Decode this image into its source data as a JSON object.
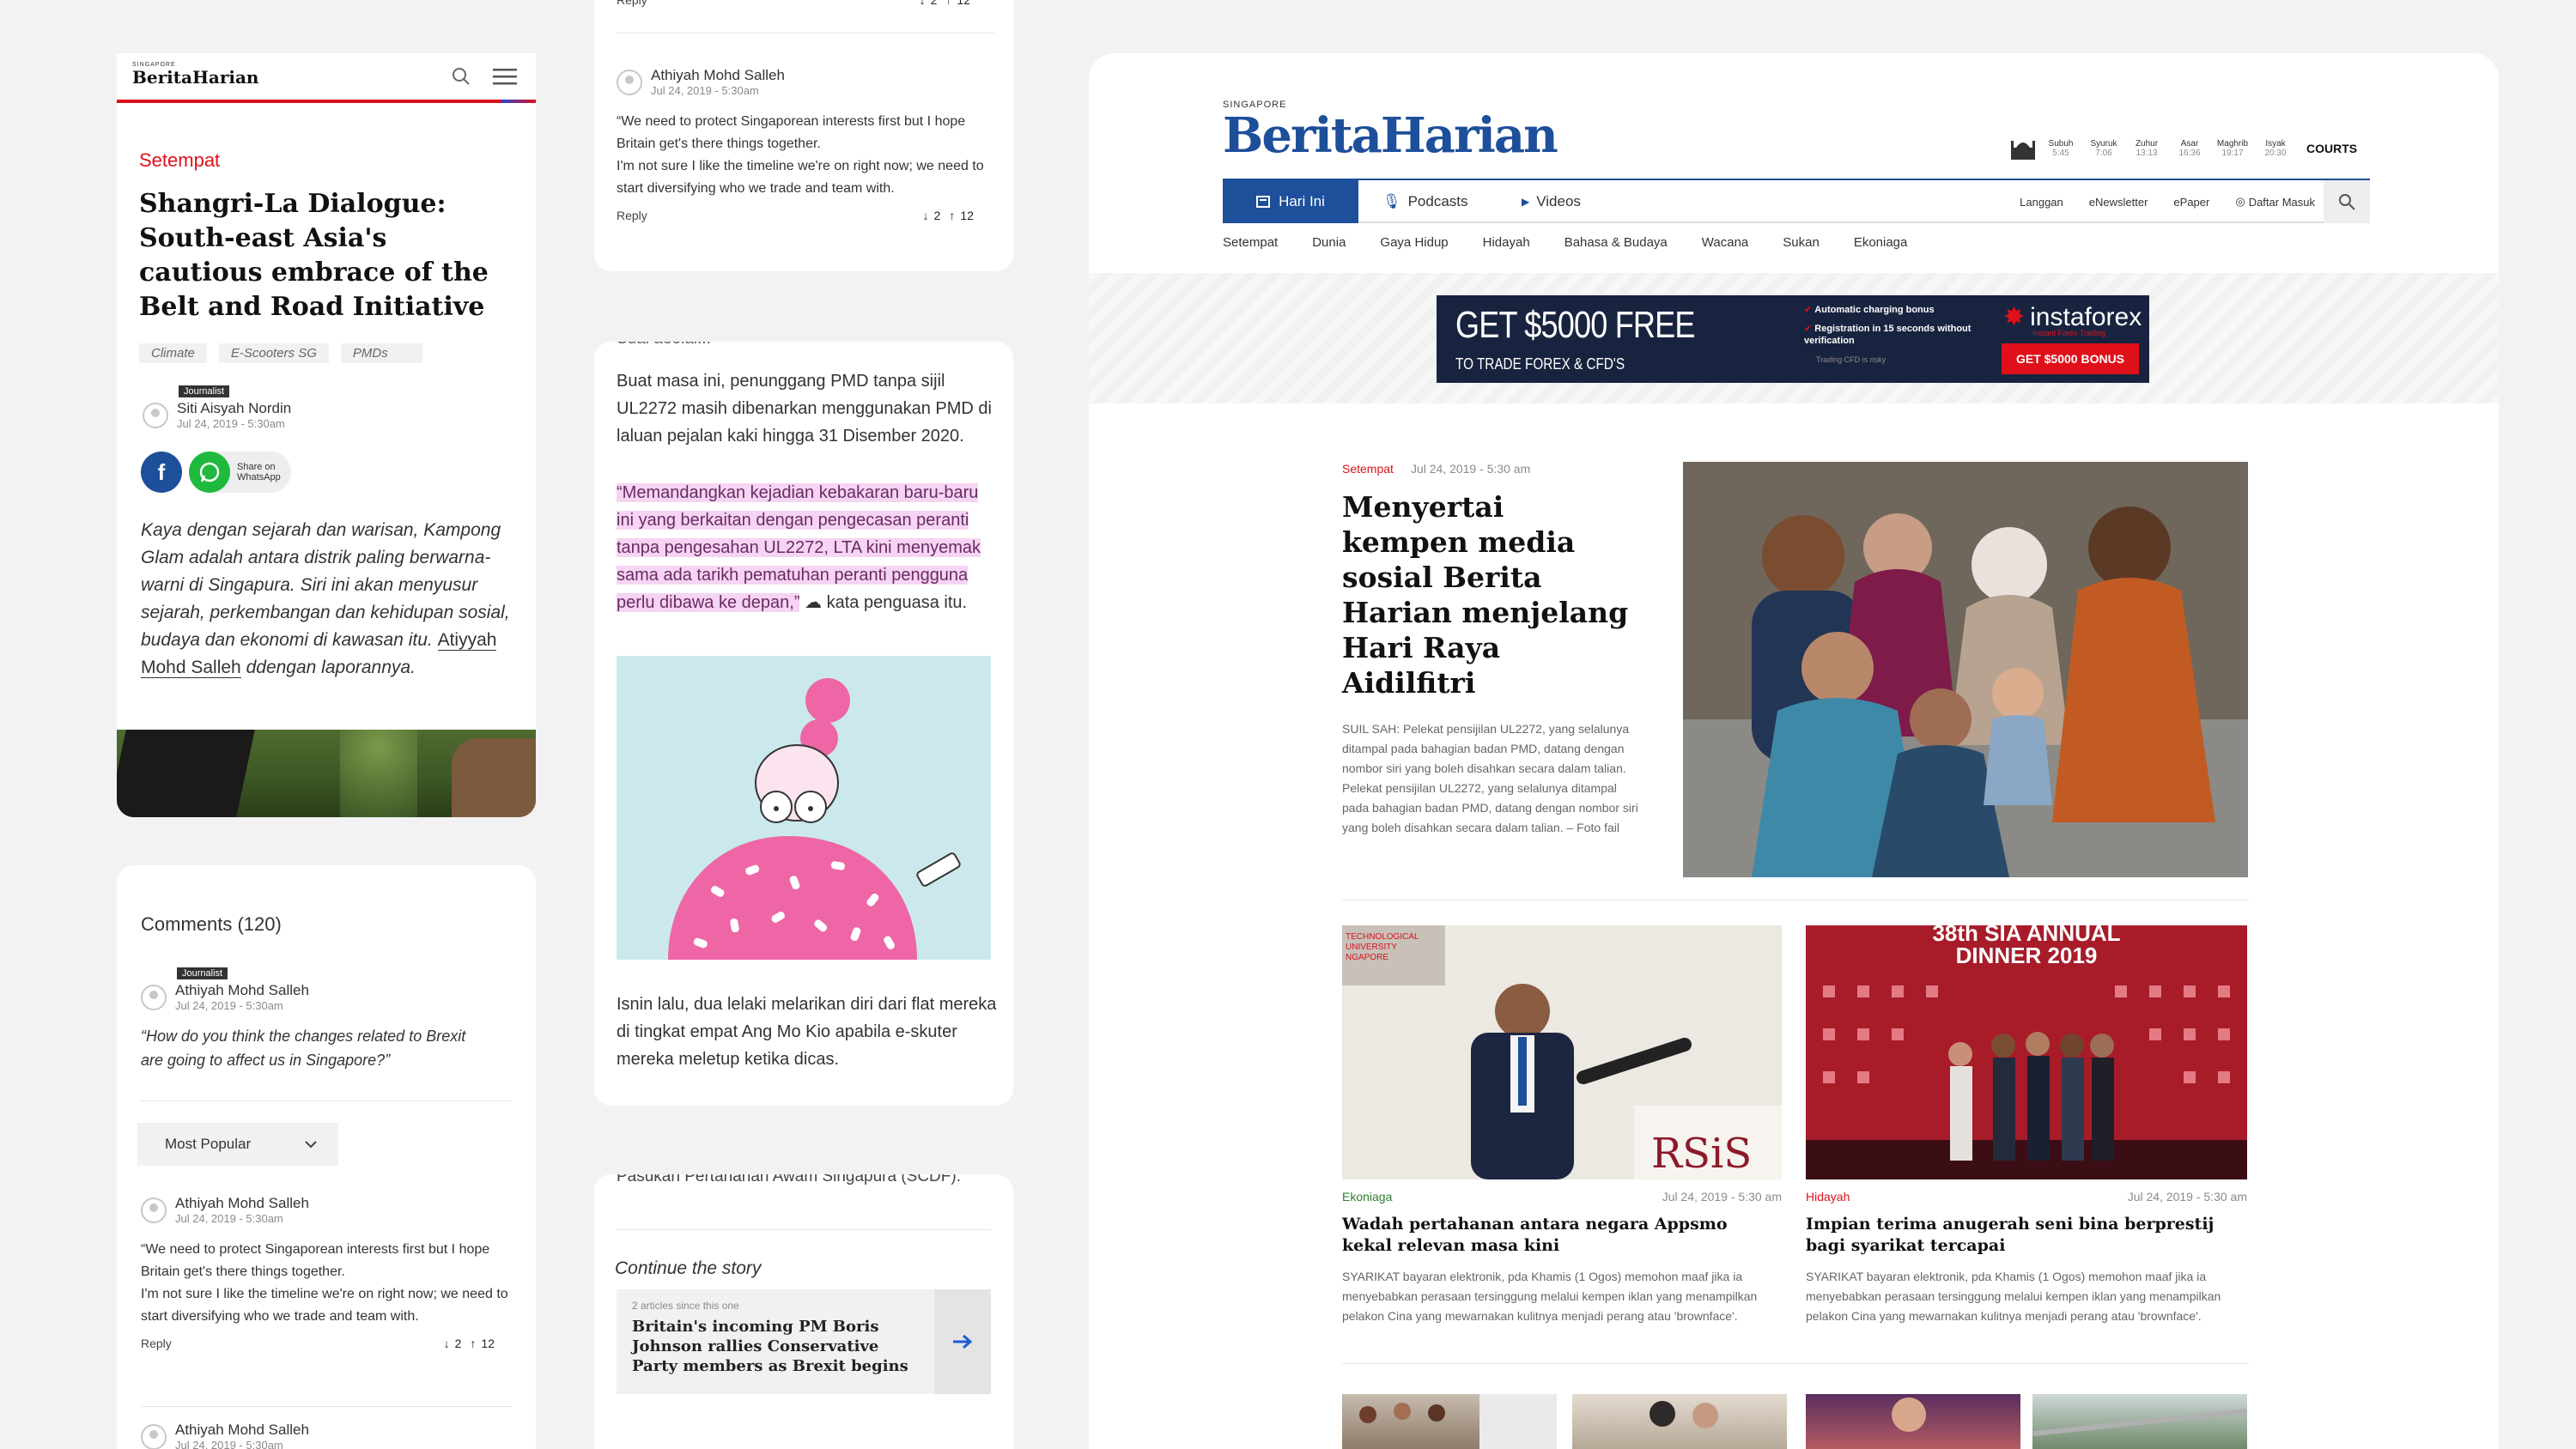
{
  "mobile_article": {
    "logo_small": "SINGAPORE",
    "logo": "BeritaHarian",
    "category": "Setempat",
    "title": "Shangri-La Dialogue: South-east Asia's cautious embrace of the Belt and Road Initiative",
    "tags": [
      "Climate",
      "E-Scooters SG",
      "PMDs"
    ],
    "author_badge": "Journalist",
    "author": "Siti Aisyah Nordin",
    "date": "Jul 24, 2019 - 5:30am",
    "share_label_1": "Share on",
    "share_label_2": "WhatsApp",
    "body_intro": "Kaya dengan sejarah dan warisan, Kampong Glam adalah antara distrik paling berwarna-warni di Singapura. Siri ini akan menyusur sejarah, perkembangan dan kehidupan sosial, budaya dan ekonomi di kawasan itu.",
    "body_author_link": "Atiyyah Mohd Salleh",
    "body_outro": "ddengan laporannya."
  },
  "mobile_comments": {
    "heading": "Comments (120)",
    "badge": "Journalist",
    "author": "Athiyah Mohd Salleh",
    "date": "Jul 24, 2019 - 5:30am",
    "question": "“How do you think the changes related to Brexit are going to affect us in Singapore?”",
    "sort_label": "Most Popular",
    "comment_author": "Athiyah Mohd Salleh",
    "comment_date": "Jul 24, 2019 - 5:30am",
    "comment_text": "“We need to protect Singaporean interests first but I hope Britain get's there things together.\nI'm not sure I like the timeline we're on right now; we need to start diversifying who we trade and team with.",
    "reply_label": "Reply",
    "down_count": "2",
    "up_count": "12",
    "next_author": "Athiyah Mohd Salleh",
    "next_date": "Jul 24, 2019 - 5:30am"
  },
  "mid_comment": {
    "top_reply": "Reply",
    "top_down": "2",
    "top_up": "12",
    "author": "Athiyah Mohd Salleh",
    "date": "Jul 24, 2019 - 5:30am",
    "text": "“We need to protect Singaporean interests first but I hope Britain get's there things together.\nI'm not sure I like the timeline we're on right now; we need to start diversifying who we trade and team with.",
    "reply_label": "Reply",
    "down_count": "2",
    "up_count": "12"
  },
  "mid_article": {
    "cut_top": "Suai aeolai...",
    "para1": "Buat masa ini, penunggang PMD tanpa sijil UL2272 masih dibenarkan menggunakan PMD di laluan pejalan kaki hingga 31 Disember 2020.",
    "quote": "“Memandangkan kejadian kebakaran baru-baru ini yang berkaitan dengan pengecasan peranti tanpa pengesahan UL2272, LTA kini menyemak sama ada tarikh pematuhan peranti pengguna perlu dibawa ke depan,”",
    "quote_after": "kata penguasa itu.",
    "para2": "Isnin lalu, dua lelaki melarikan diri dari flat mereka di tingkat empat Ang Mo Kio apabila e-skuter mereka meletup ketika dicas.",
    "cut_bottom": "Pasukan Pertahanan Awam Singapura (SCDF)."
  },
  "continue_story": {
    "cut_top": "Pasukan Pertahanan Awam Singapura (SCDF).",
    "heading": "Continue the story",
    "meta": "2 articles since this one",
    "title": "Britain's incoming PM Boris Johnson rallies Conservative Party members as Brexit begins"
  },
  "desktop": {
    "logo_small": "SINGAPORE",
    "logo": "BeritaHarian",
    "prayer_times": [
      {
        "name": "Subuh",
        "time": "5:45"
      },
      {
        "name": "Syuruk",
        "time": "7:06"
      },
      {
        "name": "Zuhur",
        "time": "13:13"
      },
      {
        "name": "Asar",
        "time": "16:36"
      },
      {
        "name": "Maghrib",
        "time": "19:17"
      },
      {
        "name": "Isyak",
        "time": "20:30"
      }
    ],
    "sponsor": "COURTS",
    "tabs": [
      "Hari Ini",
      "Podcasts",
      "Videos"
    ],
    "utility_links": [
      "Langgan",
      "eNewsletter",
      "ePaper",
      "Daftar Masuk"
    ],
    "sections": [
      "Setempat",
      "Dunia",
      "Gaya Hidup",
      "Hidayah",
      "Bahasa & Budaya",
      "Wacana",
      "Sukan",
      "Ekoniaga"
    ],
    "ad": {
      "headline": "GET $5000 FREE",
      "sub": "TO TRADE FOREX & CFD'S",
      "bullet1": "Automatic charging bonus",
      "bullet2": "Registration in 15 seconds without verification",
      "fine": "Trading CFD is risky",
      "brand": "instaforex",
      "brand_sub": "Instant Forex Trading",
      "cta": "GET $5000 BONUS"
    },
    "lead": {
      "category": "Setempat",
      "date": "Jul 24, 2019 - 5:30 am",
      "title": "Menyertai kempen media sosial Berita Harian menjelang Hari Raya Aidilfitri",
      "caption": "SUIL SAH: Pelekat pensijilan UL2272, yang selalunya ditampal pada bahagian badan PMD, datang dengan nombor siri yang boleh disahkan secara dalam talian. Pelekat pensijilan UL2272, yang selalunya ditampal pada bahagian badan PMD, datang dengan nombor siri yang boleh disahkan secara dalam talian. – Foto fail"
    },
    "stories": [
      {
        "category": "Ekoniaga",
        "date": "Jul 24, 2019 - 5:30 am",
        "title": "Wadah pertahanan antara negara Appsmo kekal relevan masa kini",
        "summary": "SYARIKAT bayaran elektronik, pda Khamis (1 Ogos) memohon maaf jika ia menyebabkan perasaan tersinggung melalui kempen iklan yang menampilkan pelakon Cina yang mewarnakan kulitnya menjadi perang atau 'brownface'.",
        "image_text": "RSiS",
        "image_corner": "TECHNOLOGICAL\nUNIVERSITY\nNGAPORE"
      },
      {
        "category": "Hidayah",
        "date": "Jul 24, 2019 - 5:30 am",
        "title": "Impian terima anugerah seni bina berprestij bagi syarikat tercapai",
        "summary": "SYARIKAT bayaran elektronik, pda Khamis (1 Ogos) memohon maaf jika ia menyebabkan perasaan tersinggung melalui kempen iklan yang menampilkan pelakon Cina yang mewarnakan kulitnya menjadi perang atau 'brownface'.",
        "image_text": "38th SIA ANNUAL\nDINNER 2019"
      }
    ]
  },
  "colors": {
    "accent": "#e0101a",
    "nav_blue": "#1d4f9a",
    "highlight": "#f6d4f3",
    "category_green": "#2e7d32"
  }
}
